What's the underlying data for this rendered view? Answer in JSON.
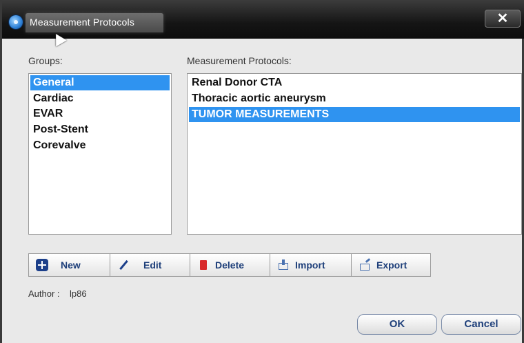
{
  "window": {
    "title": "Measurement Protocols",
    "close_label": "✕"
  },
  "groups": {
    "label": "Groups:",
    "items": [
      "General",
      "Cardiac",
      "EVAR",
      "Post-Stent",
      "Corevalve"
    ],
    "selected": "General"
  },
  "protocols": {
    "label": "Measurement Protocols:",
    "items": [
      "Renal Donor CTA",
      "Thoracic aortic aneurysm",
      "TUMOR MEASUREMENTS"
    ],
    "selected": "TUMOR MEASUREMENTS"
  },
  "toolbar": {
    "new_label": "New",
    "edit_label": "Edit",
    "delete_label": "Delete",
    "import_label": "Import",
    "export_label": "Export"
  },
  "author": {
    "label": "Author :",
    "value": "lp86"
  },
  "buttons": {
    "ok_label": "OK",
    "cancel_label": "Cancel"
  },
  "colors": {
    "selection": "#2f93f0",
    "button_text": "#1e3f7a",
    "dialog_bg": "#e9e9e9",
    "titlebar": "#151515"
  },
  "icons": [
    "app-globe-icon",
    "close-icon",
    "plus-icon",
    "pencil-icon",
    "trash-icon",
    "import-icon",
    "export-icon"
  ]
}
